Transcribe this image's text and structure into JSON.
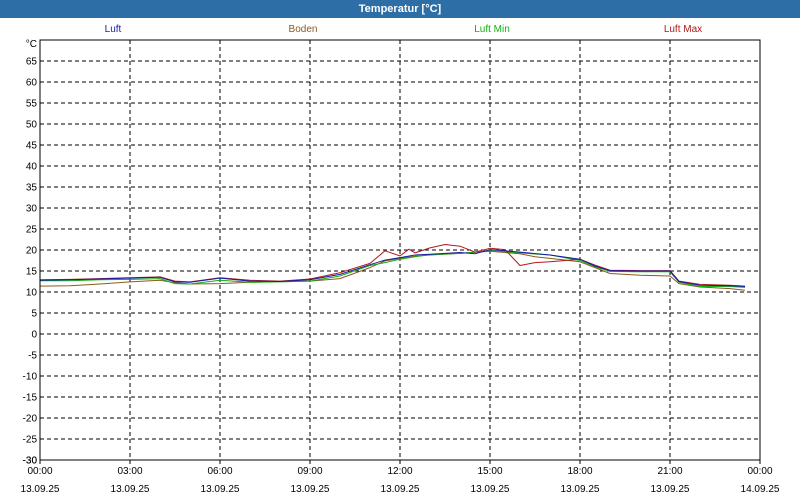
{
  "window": {
    "title": "Temperatur [°C]"
  },
  "chart_data": {
    "type": "line",
    "title": "Temperatur [°C]",
    "ylabel": "°C",
    "xlabel": "",
    "ylim": [
      -30,
      70
    ],
    "yticks": [
      -30,
      -25,
      -20,
      -15,
      -10,
      -5,
      0,
      5,
      10,
      15,
      20,
      25,
      30,
      35,
      40,
      45,
      50,
      55,
      60,
      65
    ],
    "xlim": [
      0,
      24
    ],
    "xticks": [
      {
        "x": 0,
        "time": "00:00",
        "date": "13.09.25"
      },
      {
        "x": 3,
        "time": "03:00",
        "date": "13.09.25"
      },
      {
        "x": 6,
        "time": "06:00",
        "date": "13.09.25"
      },
      {
        "x": 9,
        "time": "09:00",
        "date": "13.09.25"
      },
      {
        "x": 12,
        "time": "12:00",
        "date": "13.09.25"
      },
      {
        "x": 15,
        "time": "15:00",
        "date": "13.09.25"
      },
      {
        "x": 18,
        "time": "18:00",
        "date": "13.09.25"
      },
      {
        "x": 21,
        "time": "21:00",
        "date": "13.09.25"
      },
      {
        "x": 24,
        "time": "00:00",
        "date": "14.09.25"
      }
    ],
    "grid": true,
    "legend_position": "top",
    "series": [
      {
        "name": "Luft",
        "color": "#1a1aa8",
        "points": [
          [
            0,
            12.8
          ],
          [
            1,
            12.9
          ],
          [
            2,
            13.1
          ],
          [
            3,
            13.3
          ],
          [
            4,
            13.5
          ],
          [
            4.5,
            12.4
          ],
          [
            5,
            12.3
          ],
          [
            6,
            13.3
          ],
          [
            7,
            12.6
          ],
          [
            8,
            12.5
          ],
          [
            9,
            12.9
          ],
          [
            10,
            14.2
          ],
          [
            11,
            16.5
          ],
          [
            11.5,
            17.6
          ],
          [
            12,
            18.2
          ],
          [
            12.5,
            18.8
          ],
          [
            13,
            19.0
          ],
          [
            14,
            19.4
          ],
          [
            14.5,
            19.1
          ],
          [
            15,
            20.1
          ],
          [
            16,
            19.5
          ],
          [
            17,
            18.8
          ],
          [
            18,
            17.8
          ],
          [
            18.5,
            16.2
          ],
          [
            19,
            15.1
          ],
          [
            20,
            15.0
          ],
          [
            21,
            15.0
          ],
          [
            21.3,
            12.5
          ],
          [
            22,
            11.6
          ],
          [
            23,
            11.5
          ],
          [
            23.5,
            11.3
          ]
        ]
      },
      {
        "name": "Boden",
        "color": "#8b5a1f",
        "points": [
          [
            0,
            11.4
          ],
          [
            1,
            11.5
          ],
          [
            2,
            11.9
          ],
          [
            3,
            12.4
          ],
          [
            4,
            12.8
          ],
          [
            4.5,
            12.2
          ],
          [
            5,
            11.9
          ],
          [
            6,
            12.0
          ],
          [
            7,
            12.3
          ],
          [
            8,
            12.5
          ],
          [
            9,
            12.6
          ],
          [
            10,
            13.2
          ],
          [
            11,
            15.8
          ],
          [
            11.5,
            17.4
          ],
          [
            12,
            18.0
          ],
          [
            12.5,
            18.5
          ],
          [
            13,
            18.8
          ],
          [
            14,
            19.2
          ],
          [
            15,
            19.7
          ],
          [
            16,
            19.1
          ],
          [
            16.5,
            18.4
          ],
          [
            17,
            18.0
          ],
          [
            18,
            17.2
          ],
          [
            18.5,
            15.8
          ],
          [
            19,
            14.4
          ],
          [
            20,
            14.0
          ],
          [
            21,
            13.8
          ],
          [
            21.3,
            12.0
          ],
          [
            22,
            11.2
          ],
          [
            23,
            10.8
          ],
          [
            23.5,
            10.4
          ]
        ]
      },
      {
        "name": "Luft Min",
        "color": "#12b012",
        "points": [
          [
            0,
            12.7
          ],
          [
            1,
            12.7
          ],
          [
            2,
            12.9
          ],
          [
            3,
            13.0
          ],
          [
            4,
            13.2
          ],
          [
            4.5,
            12.0
          ],
          [
            5,
            11.9
          ],
          [
            6,
            12.8
          ],
          [
            7,
            12.3
          ],
          [
            8,
            12.4
          ],
          [
            9,
            12.6
          ],
          [
            10,
            13.8
          ],
          [
            11,
            16.3
          ],
          [
            11.5,
            17.0
          ],
          [
            12,
            17.8
          ],
          [
            12.5,
            18.4
          ],
          [
            13,
            18.9
          ],
          [
            14,
            19.2
          ],
          [
            15,
            19.8
          ],
          [
            16,
            19.3
          ],
          [
            17,
            18.8
          ],
          [
            18,
            17.5
          ],
          [
            18.5,
            16.0
          ],
          [
            19,
            14.9
          ],
          [
            20,
            14.8
          ],
          [
            21,
            14.8
          ],
          [
            21.3,
            12.3
          ],
          [
            22,
            11.3
          ],
          [
            23,
            11.3
          ],
          [
            23.5,
            11.1
          ]
        ]
      },
      {
        "name": "Luft Max",
        "color": "#b01a1a",
        "points": [
          [
            0,
            12.9
          ],
          [
            1,
            13.0
          ],
          [
            2,
            13.2
          ],
          [
            3,
            13.4
          ],
          [
            4,
            13.6
          ],
          [
            4.5,
            12.6
          ],
          [
            5,
            12.4
          ],
          [
            6,
            13.4
          ],
          [
            7,
            12.8
          ],
          [
            8,
            12.6
          ],
          [
            9,
            13.1
          ],
          [
            10,
            14.6
          ],
          [
            11,
            16.8
          ],
          [
            11.5,
            19.8
          ],
          [
            12,
            18.6
          ],
          [
            12.3,
            20.2
          ],
          [
            12.5,
            19.3
          ],
          [
            13,
            20.5
          ],
          [
            13.5,
            21.3
          ],
          [
            14,
            20.9
          ],
          [
            14.5,
            19.5
          ],
          [
            15,
            20.4
          ],
          [
            15.5,
            20.1
          ],
          [
            16,
            16.3
          ],
          [
            16.5,
            17.0
          ],
          [
            17,
            17.2
          ],
          [
            18,
            17.8
          ],
          [
            18.5,
            16.4
          ],
          [
            19,
            15.2
          ],
          [
            20,
            15.1
          ],
          [
            21,
            15.1
          ],
          [
            21.3,
            12.6
          ],
          [
            22,
            11.8
          ],
          [
            23,
            11.6
          ],
          [
            23.5,
            11.4
          ]
        ]
      }
    ]
  }
}
